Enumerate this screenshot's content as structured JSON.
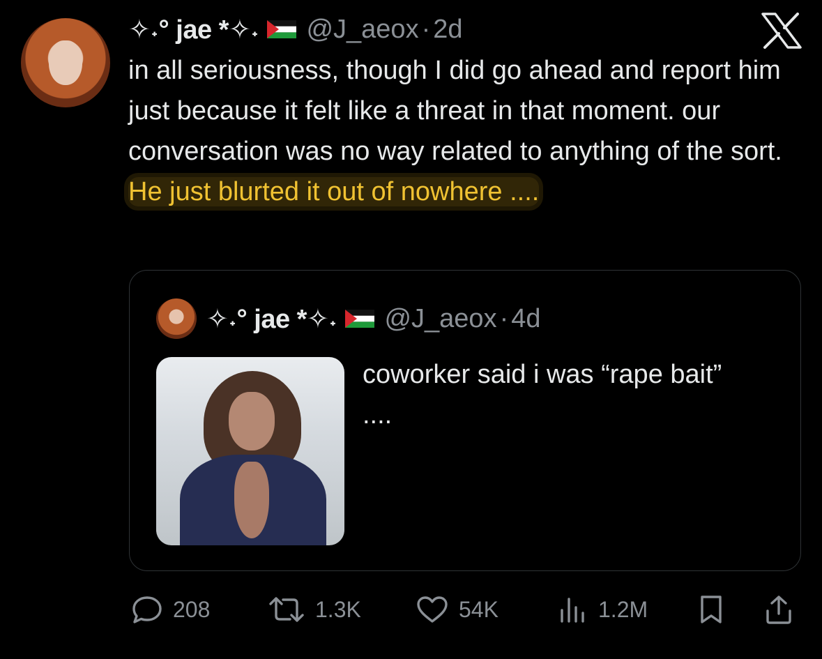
{
  "tweet": {
    "display_name_prefix": "✧˖°",
    "display_name": "jae",
    "display_name_suffix": "*✧˖",
    "flag_icon": "palestine-flag-icon",
    "handle": "@J_aeox",
    "separator": "·",
    "time": "2d",
    "text_plain": "in all seriousness, though I did go ahead and report him just because it felt like a threat in that moment. our conversation was no way related to anything of the sort. ",
    "text_highlight": "He just blurted it out of nowhere ....",
    "highlight_color": "#f0c232"
  },
  "quoted": {
    "display_name_prefix": "✧˖°",
    "display_name": "jae",
    "display_name_suffix": "*✧˖",
    "handle": "@J_aeox",
    "separator": "·",
    "time": "4d",
    "text": "coworker said i was “rape bait” ...."
  },
  "actions": {
    "replies": "208",
    "reposts": "1.3K",
    "likes": "54K",
    "views": "1.2M"
  },
  "colors": {
    "background": "#000000",
    "text": "#e7e9ea",
    "muted": "#8b9096",
    "border": "#2f3336"
  }
}
